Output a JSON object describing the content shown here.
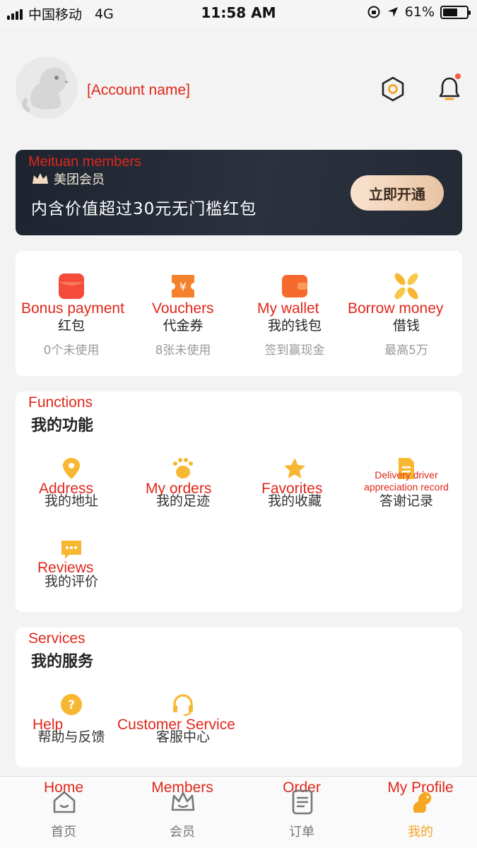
{
  "status_bar": {
    "carrier": "中国移动",
    "network": "4G",
    "time": "11:58 AM",
    "battery": "61%",
    "battery_level": 0.61
  },
  "header": {
    "account_name": "[Account name]",
    "icons": [
      "settings-hex-icon",
      "bell-icon"
    ]
  },
  "member_banner": {
    "annotation": "Meituan members",
    "badge": "美团会员",
    "headline": "内含价值超过30元无门槛红包",
    "button": "立即开通"
  },
  "wallet": {
    "items": [
      {
        "annotation": "Bonus payment",
        "title": "红包",
        "sub": "0个未使用",
        "icon": "red-envelope-icon",
        "color": "#f44b3b"
      },
      {
        "annotation": "Vouchers",
        "title": "代金券",
        "sub": "8张未使用",
        "icon": "voucher-icon",
        "color": "#f5812c"
      },
      {
        "annotation": "My wallet",
        "title": "我的钱包",
        "sub": "签到赢现金",
        "icon": "wallet-icon",
        "color": "#f56a2c"
      },
      {
        "annotation": "Borrow money",
        "title": "借钱",
        "sub": "最高5万",
        "icon": "pinwheel-icon",
        "color": "#f7b733"
      }
    ]
  },
  "functions": {
    "annotation": "Functions",
    "title": "我的功能",
    "items": [
      {
        "annotation": "Address",
        "label": "我的地址",
        "icon": "location-pin-icon"
      },
      {
        "annotation": "My orders",
        "label": "我的足迹",
        "icon": "paw-print-icon"
      },
      {
        "annotation": "Favorites",
        "label": "我的收藏",
        "icon": "star-icon"
      },
      {
        "annotation": "Delivery driver appreciation record",
        "label": "答谢记录",
        "icon": "note-icon"
      },
      {
        "annotation": "Reviews",
        "label": "我的评价",
        "icon": "chat-bubble-icon"
      }
    ]
  },
  "services": {
    "annotation": "Services",
    "title": "我的服务",
    "items": [
      {
        "annotation": "Help",
        "label": "帮助与反馈",
        "icon": "help-icon"
      },
      {
        "annotation": "Customer Service",
        "label": "客服中心",
        "icon": "headset-icon"
      }
    ]
  },
  "tabbar": {
    "tabs": [
      {
        "annotation": "Home",
        "label": "首页",
        "icon": "house-icon",
        "active": false
      },
      {
        "annotation": "Members",
        "label": "会员",
        "icon": "crown-icon",
        "active": false
      },
      {
        "annotation": "Order",
        "label": "订单",
        "icon": "order-list-icon",
        "active": false
      },
      {
        "annotation": "My Profile",
        "label": "我的",
        "icon": "kangaroo-icon",
        "active": true
      }
    ]
  },
  "colors": {
    "accent": "#f5a623",
    "annotation_red": "#e0271b",
    "banner_bg": "#232a36"
  }
}
